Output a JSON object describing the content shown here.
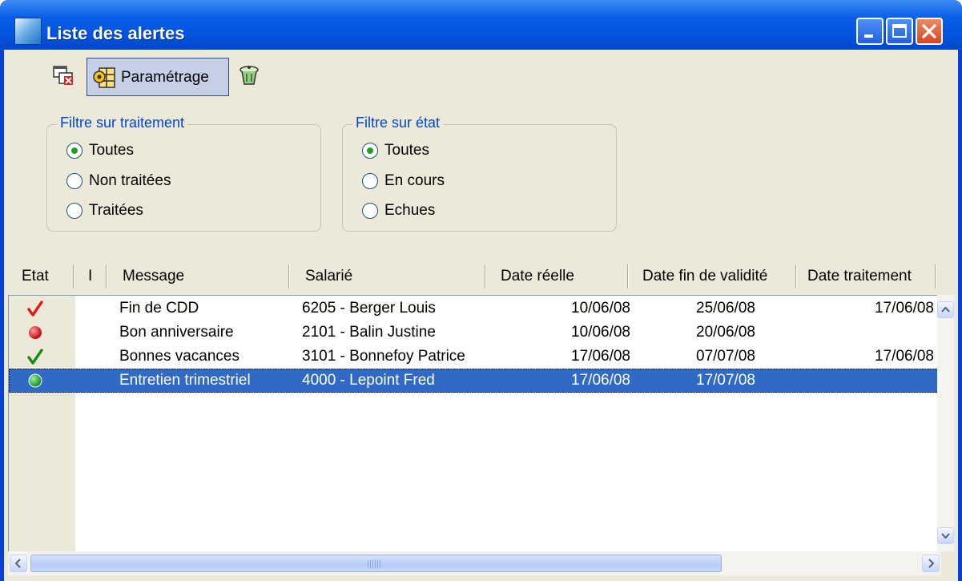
{
  "window": {
    "title": "Liste des alertes"
  },
  "toolbar": {
    "parametrage_label": "Paramétrage"
  },
  "filters": {
    "traitement": {
      "title": "Filtre sur traitement",
      "options": [
        "Toutes",
        "Non traitées",
        "Traitées"
      ],
      "selected": "Toutes"
    },
    "etat": {
      "title": "Filtre sur état",
      "options": [
        "Toutes",
        "En cours",
        "Echues"
      ],
      "selected": "Toutes"
    }
  },
  "grid": {
    "columns": [
      "Etat",
      "I",
      "Message",
      "Salarié",
      "Date réelle",
      "Date fin de validité",
      "Date traitement"
    ],
    "rows": [
      {
        "etat_icon": "red-check-icon",
        "message": "Fin de CDD",
        "salarie": "6205 - Berger Louis",
        "date_reelle": "10/06/08",
        "date_fin": "25/06/08",
        "date_traitement": "17/06/08"
      },
      {
        "etat_icon": "red-dot-icon",
        "message": "Bon anniversaire",
        "salarie": "2101 - Balin Justine",
        "date_reelle": "10/06/08",
        "date_fin": "20/06/08",
        "date_traitement": ""
      },
      {
        "etat_icon": "green-check-icon",
        "message": "Bonnes vacances",
        "salarie": "3101 - Bonnefoy Patrice",
        "date_reelle": "17/06/08",
        "date_fin": "07/07/08",
        "date_traitement": "17/06/08"
      },
      {
        "etat_icon": "green-dot-icon",
        "message": "Entretien trimestriel",
        "salarie": "4000 - Lepoint Fred",
        "date_reelle": "17/06/08",
        "date_fin": "17/07/08",
        "date_traitement": "",
        "selected": true
      }
    ]
  },
  "colors": {
    "title_bar": "#0a5ee6",
    "selection": "#316ac5",
    "group_title": "#0046d5",
    "background": "#ece9d8"
  }
}
